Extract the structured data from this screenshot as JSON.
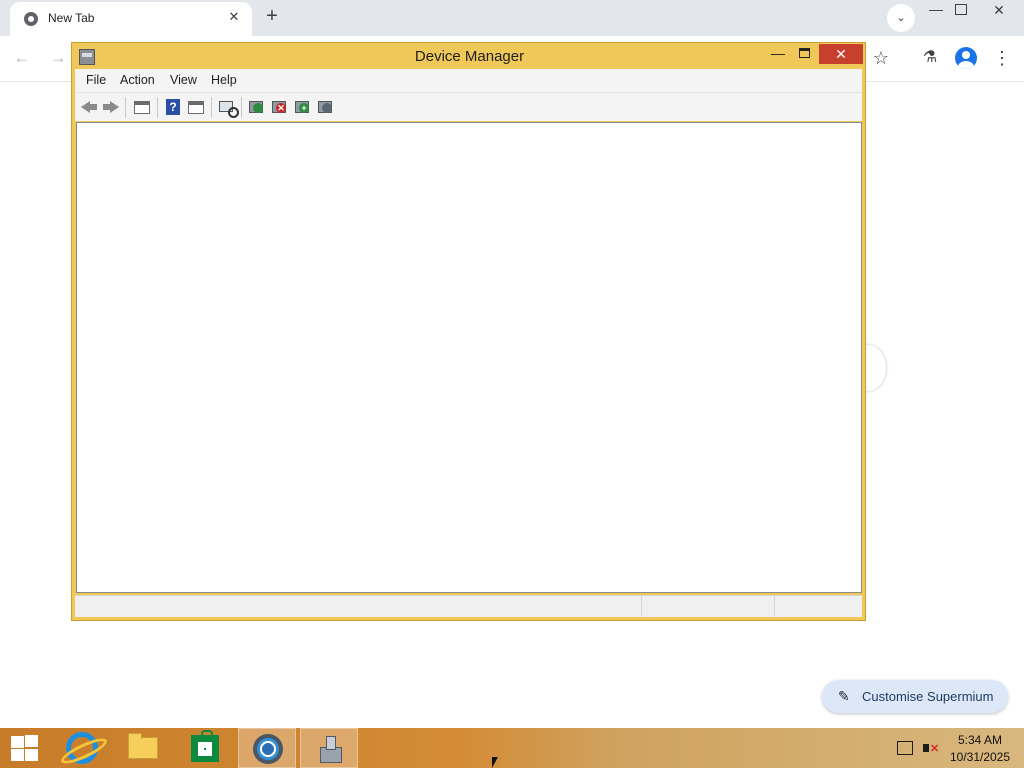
{
  "browser": {
    "tab": {
      "title": "New Tab",
      "close_glyph": "✕",
      "favicon": "chrome-icon"
    },
    "new_tab_glyph": "+",
    "tab_search_glyph": "⌄",
    "window_controls": {
      "minimize": "—",
      "close": "✕"
    },
    "toolbar": {
      "back_glyph": "←",
      "forward_glyph": "→",
      "bookmark_glyph": "☆",
      "labs_glyph": "⚗",
      "menu_glyph": "⋮"
    },
    "customise_button": {
      "icon_glyph": "✎",
      "label": "Customise Supermium",
      "bg": "#dce7f8"
    }
  },
  "device_manager": {
    "title": "Device Manager",
    "controls": {
      "minimize": "—",
      "close": "✕"
    },
    "frame_color": "#f0c85a",
    "menu": [
      "File",
      "Action",
      "View",
      "Help"
    ],
    "toolbar_icons": [
      "back-arrow-icon",
      "forward-arrow-icon",
      "show-hide-console-tree-icon",
      "help-icon",
      "properties-pane-icon",
      "scan-hardware-changes-icon",
      "update-driver-icon",
      "uninstall-device-icon",
      "add-legacy-hardware-icon",
      "enable-device-icon"
    ],
    "help_glyph": "?",
    "badges": {
      "uninstall": "✕",
      "add": "+"
    }
  },
  "taskbar": {
    "pinned_apps": [
      "start",
      "internet-explorer",
      "file-explorer",
      "store",
      "supermium-browser",
      "device-manager"
    ],
    "active_app": "device-manager",
    "tray_volume_mute_glyph": "✕",
    "clock": {
      "time": "5:34 AM",
      "date": "10/31/2025"
    }
  }
}
